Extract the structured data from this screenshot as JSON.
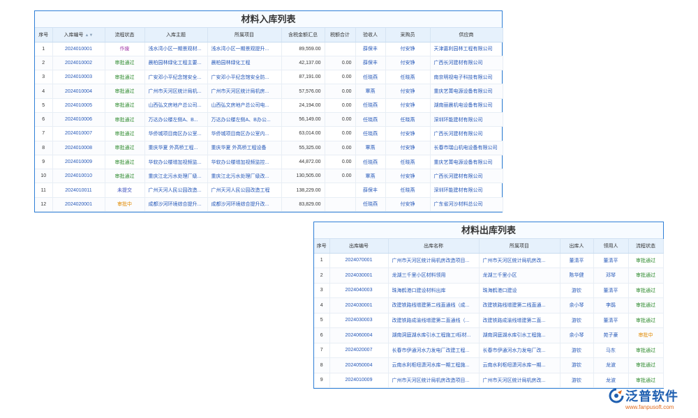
{
  "inbound": {
    "title": "材料入库列表",
    "columns": [
      "序号",
      "入库编号",
      "流程状态",
      "入库主题",
      "所属项目",
      "含税金额汇总",
      "税额合计",
      "验收人",
      "采购员",
      "供应商"
    ],
    "rows": [
      {
        "no": "1",
        "code": "2024010001",
        "status": "作废",
        "status_type": "void",
        "subject": "浅水湾小区一期景观材...",
        "project": "浅水湾小区一期景观提升...",
        "amount": "89,559.00",
        "tax": "",
        "inspector": "薛保丰",
        "buyer": "付安铮",
        "supplier": "天津嘉利园林工程有限公司"
      },
      {
        "no": "2",
        "code": "2024010002",
        "status": "审批通过",
        "status_type": "pass",
        "subject": "晨柏园林绿化工程主要...",
        "project": "晨柏园林绿化工程",
        "amount": "42,137.00",
        "tax": "0.00",
        "inspector": "薛保丰",
        "buyer": "付安铮",
        "supplier": "广西长河建材有限公司"
      },
      {
        "no": "3",
        "code": "2024010003",
        "status": "审批通过",
        "status_type": "pass",
        "subject": "广安邓小平纪念馆安全...",
        "project": "广安邓小平纪念馆安全防...",
        "amount": "87,191.00",
        "tax": "0.00",
        "inspector": "任晓燕",
        "buyer": "任晓燕",
        "supplier": "南京明视电子科技有限公司"
      },
      {
        "no": "4",
        "code": "2024010004",
        "status": "审批通过",
        "status_type": "pass",
        "subject": "广州市天河区统计局机...",
        "project": "广州市天河区统计局机房...",
        "amount": "57,576.00",
        "tax": "0.00",
        "inspector": "覃燕",
        "buyer": "付安铮",
        "supplier": "重庆艺菁电源设备有限公司"
      },
      {
        "no": "5",
        "code": "2024010005",
        "status": "审批通过",
        "status_type": "pass",
        "subject": "山西弘文房地产总公司...",
        "project": "山西弘文房地产总公司电...",
        "amount": "24,194.00",
        "tax": "0.00",
        "inspector": "任晓燕",
        "buyer": "付安铮",
        "supplier": "湖南丽晨机电设备有限公司"
      },
      {
        "no": "6",
        "code": "2024010006",
        "status": "审批通过",
        "status_type": "pass",
        "subject": "万达办公楼左侧A、B...",
        "project": "万达办公楼左侧A、B办公...",
        "amount": "56,149.00",
        "tax": "0.00",
        "inspector": "任晓燕",
        "buyer": "任晓燕",
        "supplier": "深圳环能建材有限公司"
      },
      {
        "no": "7",
        "code": "2024010007",
        "status": "审批通过",
        "status_type": "pass",
        "subject": "华侨城项目南区办公室...",
        "project": "华侨城项目南区办公室内...",
        "amount": "63,014.00",
        "tax": "0.00",
        "inspector": "任晓燕",
        "buyer": "付安铮",
        "supplier": "广西长河建材有限公司"
      },
      {
        "no": "8",
        "code": "2024010008",
        "status": "审批通过",
        "status_type": "pass",
        "subject": "重庆华夏 外高桥工程...",
        "project": "重庆华夏 外高桥工程设备",
        "amount": "55,325.00",
        "tax": "0.00",
        "inspector": "覃燕",
        "buyer": "付安铮",
        "supplier": "长春市瑞山机电设备有限公司"
      },
      {
        "no": "9",
        "code": "2024010009",
        "status": "审批通过",
        "status_type": "pass",
        "subject": "华软办公楼增加视频监...",
        "project": "华软办公楼增加视频监控...",
        "amount": "44,872.00",
        "tax": "0.00",
        "inspector": "任晓燕",
        "buyer": "任晓燕",
        "supplier": "重庆艺菁电源设备有限公司"
      },
      {
        "no": "10",
        "code": "2024010010",
        "status": "审批通过",
        "status_type": "pass",
        "subject": "重庆江北污水处理厂级...",
        "project": "重庆江北污水处理厂级改...",
        "amount": "130,505.00",
        "tax": "0.00",
        "inspector": "覃燕",
        "buyer": "付安铮",
        "supplier": "广西长河建材有限公司"
      },
      {
        "no": "11",
        "code": "2024010011",
        "status": "未提交",
        "status_type": "unsub",
        "subject": "广州天河人民公园改造...",
        "project": "广州天河人民公园改造工程",
        "amount": "138,229.00",
        "tax": "",
        "inspector": "薛保丰",
        "buyer": "任晓燕",
        "supplier": "深圳环能建材有限公司"
      },
      {
        "no": "12",
        "code": "2024020001",
        "status": "审批中",
        "status_type": "review",
        "subject": "成都沙河环境综合提升...",
        "project": "成都沙河环境综合提升改...",
        "amount": "83,829.00",
        "tax": "",
        "inspector": "任晓燕",
        "buyer": "付安铮",
        "supplier": "广东省河沙材料总公司"
      }
    ]
  },
  "outbound": {
    "title": "材料出库列表",
    "columns": [
      "序号",
      "出库编号",
      "出库名称",
      "所属项目",
      "出库人",
      "领用人",
      "流程状态"
    ],
    "rows": [
      {
        "no": "1",
        "code": "2024070001",
        "name": "广州市天河区统计局机房改造项目...",
        "project": "广州市天河区统计局机房改...",
        "issuer": "董清平",
        "receiver": "董清平",
        "status": "审批通过",
        "status_type": "pass"
      },
      {
        "no": "2",
        "code": "2024030001",
        "name": "龙湖三千里小区材料领用",
        "project": "龙湖三千里小区",
        "issuer": "陈华健",
        "receiver": "邓琴",
        "status": "审批通过",
        "status_type": "pass"
      },
      {
        "no": "3",
        "code": "2024040003",
        "name": "珠海鹤港口建设材料出库",
        "project": "珠海鹤港口建设",
        "issuer": "游钦",
        "receiver": "董清平",
        "status": "审批通过",
        "status_type": "pass"
      },
      {
        "no": "4",
        "code": "2024030001",
        "name": "改建铁路线增建第二线直通线（成...",
        "project": "改建铁路线增建第二线直通...",
        "issuer": "余小琴",
        "receiver": "李鹃",
        "status": "审批通过",
        "status_type": "pass"
      },
      {
        "no": "5",
        "code": "2024030003",
        "name": "改建铁路成渝线增建第二直通线（...",
        "project": "改建铁路成渝线增建第二直...",
        "issuer": "游钦",
        "receiver": "董清平",
        "status": "审批通过",
        "status_type": "pass"
      },
      {
        "no": "6",
        "code": "2024060004",
        "name": "湖南洞庭湖水库引水工程施工I标材...",
        "project": "湖南洞庭湖水库引水工程施...",
        "issuer": "余小琴",
        "receiver": "苑子豪",
        "status": "审批中",
        "status_type": "review"
      },
      {
        "no": "7",
        "code": "2024020007",
        "name": "长春市伊通河水力发电厂改建工程...",
        "project": "长春市伊通河水力发电厂改...",
        "issuer": "游钦",
        "receiver": "马东",
        "status": "审批通过",
        "status_type": "pass"
      },
      {
        "no": "8",
        "code": "2024050004",
        "name": "云南水利枢纽潇河水库一期工程施...",
        "project": "云南水利枢纽潇河水库一期...",
        "issuer": "游钦",
        "receiver": "龙波",
        "status": "审批通过",
        "status_type": "pass"
      },
      {
        "no": "9",
        "code": "2024010009",
        "name": "广州市天河区统计局机房改造项目...",
        "project": "广州市天河区统计局机房改...",
        "issuer": "游钦",
        "receiver": "龙波",
        "status": "审批通过",
        "status_type": "pass"
      }
    ]
  },
  "logo": {
    "brand": "泛普软件",
    "url": "www.fanpusoft.com"
  },
  "icons": {
    "sort": "sort-icon"
  },
  "colors": {
    "border": "#2f7fd6",
    "link": "#2457b8",
    "pass": "#2e8b2e",
    "void": "#a23aa8",
    "review": "#e08a00",
    "unsub": "#3a4fbf"
  }
}
